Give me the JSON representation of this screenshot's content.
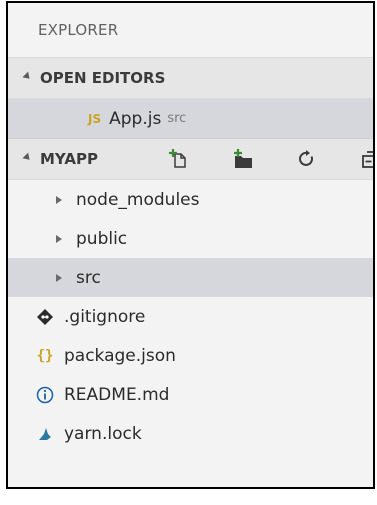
{
  "explorer": {
    "title": "EXPLORER"
  },
  "open_editors": {
    "header": "OPEN EDITORS",
    "items": [
      {
        "icon": "js-file-icon",
        "icon_text": "JS",
        "name": "App.js",
        "dir": "src"
      }
    ]
  },
  "project": {
    "header": "MYAPP",
    "actions": [
      {
        "name": "new-file-icon"
      },
      {
        "name": "new-folder-icon"
      },
      {
        "name": "refresh-icon"
      },
      {
        "name": "collapse-all-icon"
      }
    ],
    "folders": [
      {
        "label": "node_modules"
      },
      {
        "label": "public"
      },
      {
        "label": "src"
      }
    ],
    "files": [
      {
        "label": ".gitignore",
        "icon": "git-icon"
      },
      {
        "label": "package.json",
        "icon": "json-icon",
        "icon_text": "{}"
      },
      {
        "label": "README.md",
        "icon": "info-icon"
      },
      {
        "label": "yarn.lock",
        "icon": "yarn-icon"
      }
    ]
  },
  "colors": {
    "panel_bg": "#f3f3f3",
    "selected_bg": "#d6d7dc",
    "accent_green": "#388a34",
    "js_yellow": "#c9a321"
  }
}
